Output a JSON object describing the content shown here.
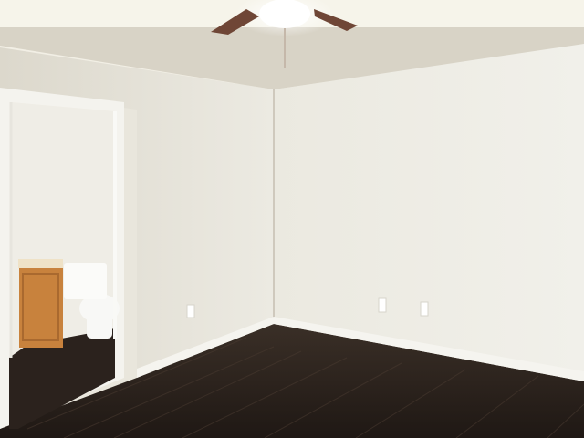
{
  "scene": {
    "colors": {
      "ceiling_light": "#f3f1e6",
      "ceiling_shadow": "#cfcbbf",
      "wall_left": "#e6e3d8",
      "wall_right": "#ecebe2",
      "trim": "#f7f6f1",
      "floor": "#2f2620",
      "floor_dark": "#221b17",
      "door_frame": "#f4f3ee",
      "bathroom_wall": "#f3f0e7",
      "cabinet": "#c8823d",
      "counter": "#efe2c7",
      "toilet": "#f8f8f6",
      "fan_blade": "#6f4636",
      "outlet": "#ffffff"
    },
    "objects": [
      {
        "name": "ceiling-fan",
        "label": ""
      },
      {
        "name": "open-doorway",
        "label": ""
      },
      {
        "name": "bathroom-toilet",
        "label": ""
      },
      {
        "name": "bathroom-vanity",
        "label": ""
      },
      {
        "name": "dark-wood-floor",
        "label": ""
      },
      {
        "name": "wall-outlets",
        "label": ""
      }
    ]
  }
}
